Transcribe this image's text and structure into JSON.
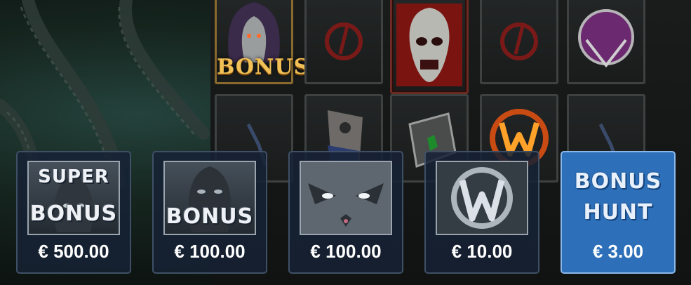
{
  "reel_symbols": {
    "bonus_scatter_label": "BONUS"
  },
  "bonus_buy": {
    "options": [
      {
        "title_line1": "SUPER",
        "title_line2": "BONUS",
        "price": "€ 500.00",
        "icon": "demon-face-icon",
        "selected": false
      },
      {
        "title_line1": "",
        "title_line2": "BONUS",
        "price": "€ 100.00",
        "icon": "demon-face-icon",
        "selected": false
      },
      {
        "title_line1": "",
        "title_line2": "",
        "price": "€ 100.00",
        "icon": "monster-face-icon",
        "selected": false
      },
      {
        "title_line1": "",
        "title_line2": "",
        "price": "€ 10.00",
        "icon": "wild-w-icon",
        "selected": false
      },
      {
        "title_line1": "BONUS",
        "title_line2": "HUNT",
        "price": "€ 3.00",
        "icon": "",
        "selected": true
      }
    ]
  },
  "colors": {
    "panel_bg": "#162234",
    "panel_selected_bg": "#2d6fb8",
    "bonus_gold": "#f1c157"
  }
}
